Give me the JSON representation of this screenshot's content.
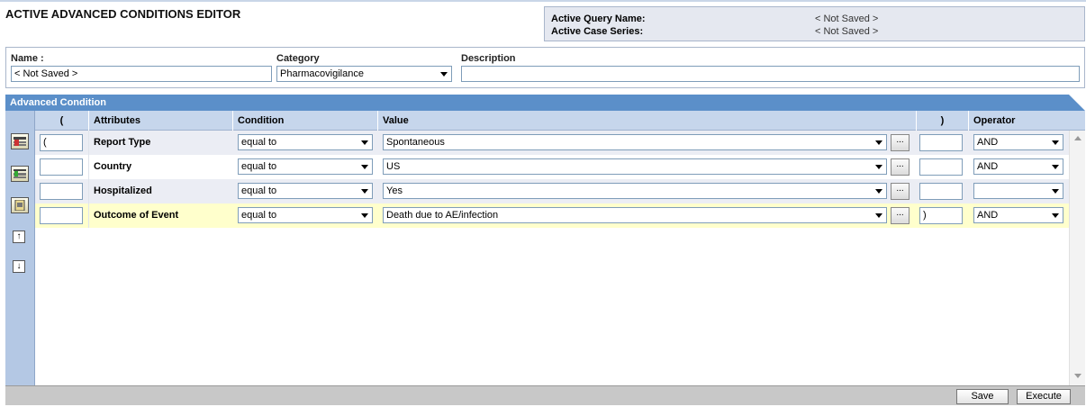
{
  "page": {
    "title": "ACTIVE ADVANCED CONDITIONS EDITOR"
  },
  "active": {
    "query_label": "Active Query Name:",
    "query_value": "< Not Saved >",
    "case_label": "Active Case Series:",
    "case_value": "< Not Saved >"
  },
  "form": {
    "name_label": "Name :",
    "name_value": "< Not Saved >",
    "category_label": "Category",
    "category_value": "Pharmacovigilance",
    "description_label": "Description",
    "description_value": ""
  },
  "advanced": {
    "section_title": "Advanced Condition",
    "columns": {
      "open": "(",
      "attributes": "Attributes",
      "condition": "Condition",
      "value": "Value",
      "close": ")",
      "operator": "Operator"
    },
    "rows": [
      {
        "open": "(",
        "attribute": "Report Type",
        "condition": "equal to",
        "value": "Spontaneous",
        "close": "",
        "operator": "AND"
      },
      {
        "open": "",
        "attribute": "Country",
        "condition": "equal to",
        "value": "US",
        "close": "",
        "operator": "AND"
      },
      {
        "open": "",
        "attribute": "Hospitalized",
        "condition": "equal to",
        "value": "Yes",
        "close": "",
        "operator": ""
      },
      {
        "open": "",
        "attribute": "Outcome of Event",
        "condition": "equal to",
        "value": "Death due to AE/infection",
        "close": ")",
        "operator": "AND"
      }
    ],
    "ellipsis": "..."
  },
  "footer": {
    "save_label": "Save",
    "execute_label": "Execute"
  },
  "colors": {
    "header_blue": "#5b8fc9",
    "highlight_row": "#ffffcc",
    "alt_row": "#ebedf4"
  }
}
